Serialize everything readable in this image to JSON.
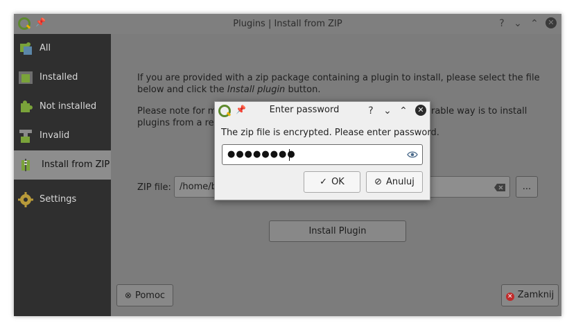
{
  "window": {
    "title": "Plugins | Install from ZIP",
    "help_glyph": "?",
    "minimize_glyph": "⌄",
    "maximize_glyph": "⌃",
    "close_glyph": "✕",
    "pin_glyph": "📌"
  },
  "sidebar": {
    "items": [
      {
        "label": "All",
        "icon": "puzzle-all-icon"
      },
      {
        "label": "Installed",
        "icon": "puzzle-installed-icon"
      },
      {
        "label": "Not installed",
        "icon": "puzzle-not-installed-icon"
      },
      {
        "label": "Invalid",
        "icon": "puzzle-invalid-icon"
      },
      {
        "label": "Install from ZIP",
        "icon": "puzzle-zip-icon",
        "active": true
      },
      {
        "label": "Settings",
        "icon": "gear-icon"
      }
    ]
  },
  "content": {
    "para1_a": "If you are provided with a zip package containing a plugin to install, please select the file",
    "para1_b_pre": "below and click the ",
    "para1_b_em": "Install plugin",
    "para1_b_post": " button.",
    "para2_a_left": "Please note for mo",
    "para2_a_right": "rable way is to install",
    "para2_b": "plugins from a rep",
    "zip_label": "ZIP file:",
    "zip_value": "/home/b",
    "browse_label": "...",
    "install_button": "Install Plugin"
  },
  "footer": {
    "help_button": "Pomoc",
    "close_button": "Zamknij"
  },
  "dialog": {
    "title": "Enter password",
    "help_glyph": "?",
    "minimize_glyph": "⌄",
    "maximize_glyph": "⌃",
    "close_glyph": "✕",
    "message": "The zip file is encrypted. Please enter password.",
    "password_masked": "●●●●●●●●",
    "ok_button": "OK",
    "cancel_button": "Anuluj"
  },
  "colors": {
    "accent_green": "#5d8a2e",
    "sidebar_bg": "#2f2f2f",
    "dialog_bg": "#efefef"
  }
}
